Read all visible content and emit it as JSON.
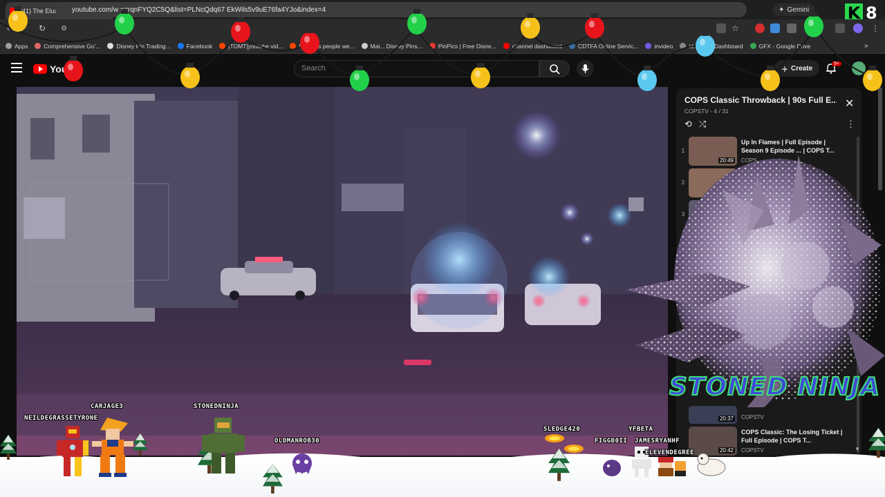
{
  "browser": {
    "tab_title": "(41) The Elusive Pursuit | FU",
    "tab_close": "×",
    "new_tab": "+",
    "gemini_label": "Gemini",
    "url": "youtube.com/w         =zrqnFYQ2C5Q&list=PLNcQdq67        EkWils5v9uE76fa4YJo&index=4",
    "reload": "↻",
    "bookmarks": [
      {
        "label": "Apps",
        "color": "#9aa0a6"
      },
      {
        "label": "Comprehensive Go'...",
        "color": "#e06666"
      },
      {
        "label": "Disney Pin Trading...",
        "color": "#dddddd"
      },
      {
        "label": "Facebook",
        "color": "#1877f2"
      },
      {
        "label": "[TOMT]youtube vid...",
        "color": "#ff4500"
      },
      {
        "label": "If todays people we...",
        "color": "#ff4500"
      },
      {
        "label": "Mai... Disney Pins...",
        "color": "#cccccc"
      },
      {
        "label": "PinPics | Free Disne...",
        "color": "#e53935"
      },
      {
        "label": "channel dashboard",
        "color": "#ff0000"
      },
      {
        "label": "CDTFA Online Servic...",
        "color": "#3b6ea5"
      },
      {
        "label": "invideo",
        "color": "#6c5ce7"
      },
      {
        "label": "id...",
        "color": "#888888"
      },
      {
        "label": "Dashboard",
        "color": "#eeeeee"
      },
      {
        "label": "GFX - Google Drive",
        "color": "#34a853"
      }
    ]
  },
  "youtube": {
    "logo": "YouT",
    "search_placeholder": "Search",
    "create_label": "Create",
    "notif_badge": "9+"
  },
  "playlist": {
    "title": "COPS Classic Throwback | 90s Full E...",
    "subtitle": "COPSTV - 4 / 31",
    "close": "✕",
    "items": [
      {
        "index": "1",
        "title": "Up In Flames | Full Episode | Season 9 Episode ... | COPS T...",
        "channel": "COPS",
        "duration": "20:49",
        "thumb_color": "#7a5d52"
      },
      {
        "index": "2",
        "title": "",
        "channel": "",
        "duration": "20:13",
        "thumb_color": "#8a6a5a"
      },
      {
        "index": "3",
        "title": "",
        "channel": "",
        "duration": "20:49",
        "thumb_color": "#5d5a6e"
      },
      {
        "index": "▶",
        "title": "",
        "channel": "",
        "duration": "",
        "thumb_color": "#33303a"
      },
      {
        "index": "",
        "title": "",
        "channel": "COPSTV",
        "duration": "20:37",
        "thumb_color": "#3a3f55"
      },
      {
        "index": "",
        "title": "COPS Classic: The Losing Ticket | Full Episode | COPS T...",
        "channel": "COPSTV",
        "duration": "20:42",
        "thumb_color": "#5a4a48"
      }
    ]
  },
  "overlay": {
    "brand": "STONED NINJA",
    "badge_letter": "K",
    "badge_number": "8",
    "usernames": [
      {
        "name": "CARJAGE3"
      },
      {
        "name": "NEILDEGRASSETYRONE"
      },
      {
        "name": "STONEDNINJA"
      },
      {
        "name": "OLDMANROB30"
      },
      {
        "name": "SLEDGE420"
      },
      {
        "name": "YFBETA"
      },
      {
        "name": "FIGGB0II"
      },
      {
        "name": "JAMESRYANHF"
      },
      {
        "name": "ELEVENDEGREE"
      }
    ]
  },
  "colors": {
    "light_red": "#e8141c",
    "light_green": "#22d14a",
    "light_yellow": "#f6c21a",
    "light_blue": "#5bc8ef",
    "brand_blue": "#3f4ad8",
    "brand_green": "#3fe07a"
  }
}
